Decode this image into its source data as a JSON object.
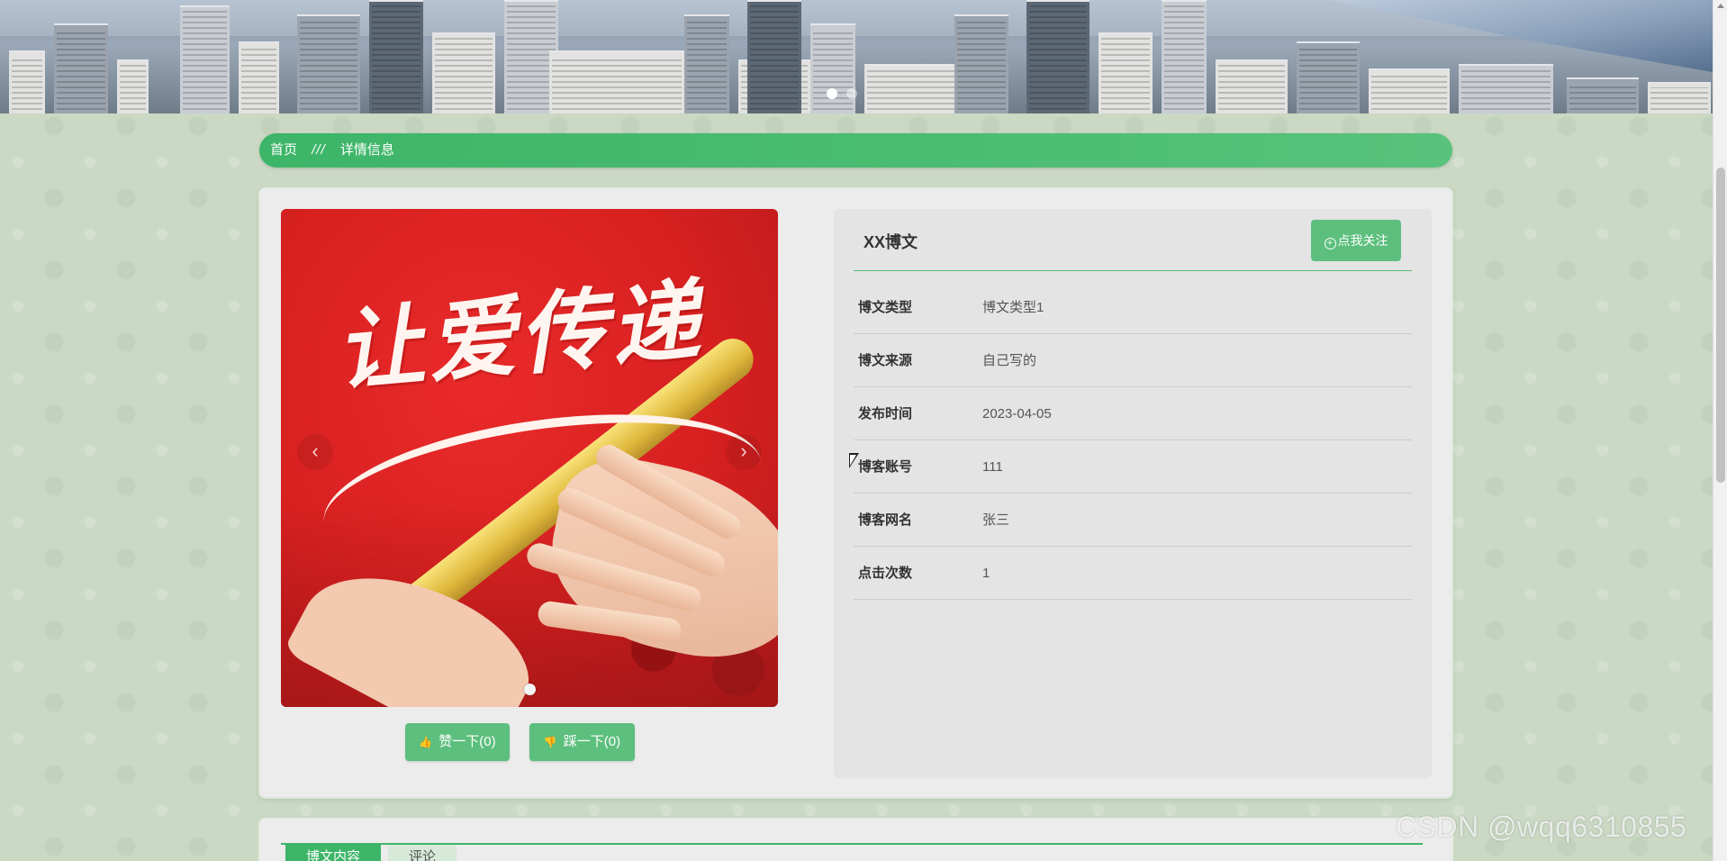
{
  "banner": {
    "slides": 2
  },
  "breadcrumb": {
    "home": "首页",
    "separator": "///",
    "current": "详情信息"
  },
  "carousel": {
    "slogan": "让爱传递",
    "prev": "‹",
    "next": "›"
  },
  "actions": {
    "like_label": "赞一下(0)",
    "dislike_label": "踩一下(0)"
  },
  "detail": {
    "title": "XX博文",
    "follow_label": "点我关注",
    "fields": [
      {
        "label": "博文类型",
        "value": "博文类型1"
      },
      {
        "label": "博文来源",
        "value": "自己写的"
      },
      {
        "label": "发布时间",
        "value": "2023-04-05"
      },
      {
        "label": "博客账号",
        "value": "111"
      },
      {
        "label": "博客网名",
        "value": "张三"
      },
      {
        "label": "点击次数",
        "value": "1"
      }
    ]
  },
  "tabs": [
    {
      "label": "博文内容",
      "active": true
    },
    {
      "label": "评论",
      "active": false
    }
  ],
  "watermark": "CSDN @wqq6310855",
  "colors": {
    "accent": "#3db568",
    "button": "#5cbf7d"
  }
}
